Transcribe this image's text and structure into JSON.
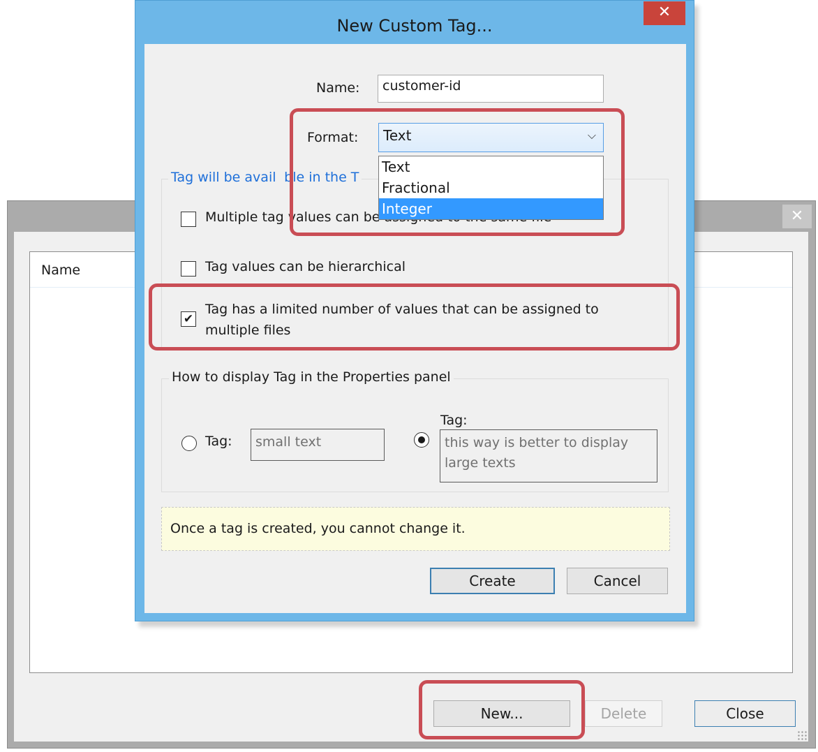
{
  "background_window": {
    "close_glyph": "✕",
    "list_header": {
      "name_column": "Name"
    },
    "buttons": {
      "new": "New...",
      "delete": "Delete",
      "close": "Close"
    }
  },
  "dialog": {
    "title": "New Custom Tag...",
    "close_glyph": "✕",
    "name": {
      "label": "Name:",
      "value": "customer-id"
    },
    "format": {
      "label": "Format:",
      "selected": "Text",
      "arrow": "⌄",
      "options": [
        "Text",
        "Fractional",
        "Integer"
      ],
      "highlighted_option": "Integer"
    },
    "availability_group": {
      "legend": "Tag will be avail",
      "legend_tail": "ble in the T",
      "checkboxes": [
        {
          "label": "Multiple tag values can be assigned to the same file",
          "checked": false
        },
        {
          "label": "Tag values can be hierarchical",
          "checked": false
        },
        {
          "label": "Tag has a limited number of values that can be assigned to multiple files",
          "checked": true
        }
      ]
    },
    "display_group": {
      "legend": "How to display Tag in the Properties panel",
      "option_small": {
        "label": "Tag:",
        "preview": "small text",
        "selected": false
      },
      "option_large": {
        "label": "Tag:",
        "preview": "this way is better to display large texts",
        "selected": true
      }
    },
    "notice": "Once a tag is created, you cannot change it.",
    "buttons": {
      "create": "Create",
      "cancel": "Cancel"
    }
  },
  "colors": {
    "accent": "#6db7e8",
    "highlight": "#c94d55",
    "close_red": "#c9443b",
    "selection": "#3399ff",
    "link_blue": "#1e6fd9"
  }
}
